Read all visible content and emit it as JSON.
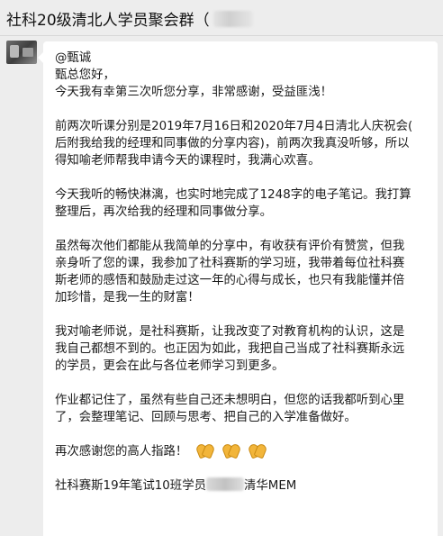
{
  "chat": {
    "title": "社科20级清北人学员聚会群（"
  },
  "message": {
    "mention": "@甄诚",
    "greeting": "甄总您好，",
    "p1": "今天我有幸第三次听您分享，非常感谢，受益匪浅！",
    "p2_l1": "前两次听课分别是2019年7月16日和2020年7月4日清北人庆祝会(",
    "p2_l2": "后附我给我的经理和同事做的分享内容)，前两次我真没听够，所以",
    "p2_l3": "得知喻老师帮我申请今天的课程时，我满心欢喜。",
    "p3_l1": "今天我听的畅快淋漓，也实时地完成了1248字的电子笔记。我打算",
    "p3_l2": "整理后，再次给我的经理和同事做分享。",
    "p4_l1": "虽然每次他们都能从我简单的分享中，有收获有评价有赞赏，但我",
    "p4_l2": "亲身听了您的课，我参加了社科赛斯的学习班，我带着每位社科赛",
    "p4_l3": "斯老师的感悟和鼓励走过这一年的心得与成长，也只有我能懂并倍",
    "p4_l4": "加珍惜，是我一生的财富！",
    "p5_l1": "我对喻老师说，是社科赛斯，让我改变了对教育机构的认识，这是",
    "p5_l2": "我自己都想不到的。也正因为如此，我把自己当成了社科赛斯永远",
    "p5_l3": "的学员，更会在此与各位老师学习到更多。",
    "p6_l1": "作业都记住了，虽然有些自己还未想明白，但您的话我都听到心里",
    "p6_l2": "了，会整理笔记、回顾与思考、把自己的入学准备做好。",
    "p7": "再次感谢您的高人指路！",
    "signature_prefix": "社科赛斯19年笔试10班学员",
    "signature_suffix": "清华MEM"
  },
  "icons": {
    "emoji": "clap-hands",
    "emoji_color": "#f2b53a"
  }
}
